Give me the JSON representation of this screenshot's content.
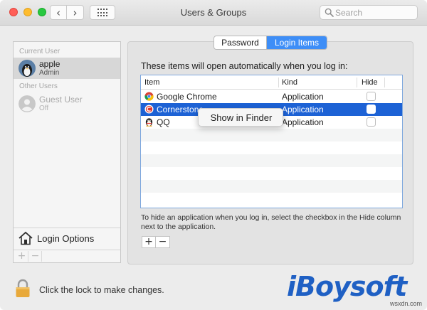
{
  "window": {
    "title": "Users & Groups",
    "search_placeholder": "Search"
  },
  "sidebar": {
    "current_user_label": "Current User",
    "current_user": {
      "name": "apple",
      "role": "Admin"
    },
    "other_users_label": "Other Users",
    "other_users": [
      {
        "name": "Guest User",
        "status": "Off"
      }
    ],
    "login_options_label": "Login Options",
    "add_symbol": "+",
    "remove_symbol": "−"
  },
  "tabs": [
    {
      "label": "Password",
      "selected": false
    },
    {
      "label": "Login Items",
      "selected": true
    }
  ],
  "login_items": {
    "intro": "These items will open automatically when you log in:",
    "columns": {
      "item": "Item",
      "kind": "Kind",
      "hide": "Hide"
    },
    "rows": [
      {
        "icon": "chrome-icon",
        "name": "Google Chrome",
        "kind": "Application",
        "hide": false,
        "selected": false
      },
      {
        "icon": "cornerstone-icon",
        "name": "Cornerstone",
        "kind": "Application",
        "hide": false,
        "selected": true
      },
      {
        "icon": "qq-penguin-icon",
        "name": "QQ",
        "kind": "Application",
        "hide": false,
        "selected": false
      }
    ],
    "context_menu": {
      "item": "Show in Finder"
    },
    "hint": "To hide an application when you log in, select the checkbox in the Hide column next to the application.",
    "add_symbol": "+",
    "remove_symbol": "−"
  },
  "footer": {
    "lock_text": "Click the lock to make changes."
  },
  "watermark": {
    "brand": "iBoysoft",
    "site": "wsxdn.com"
  },
  "colors": {
    "accent": "#3e8ef7",
    "selection": "#1d62d5",
    "watermark": "#1f60c4"
  }
}
